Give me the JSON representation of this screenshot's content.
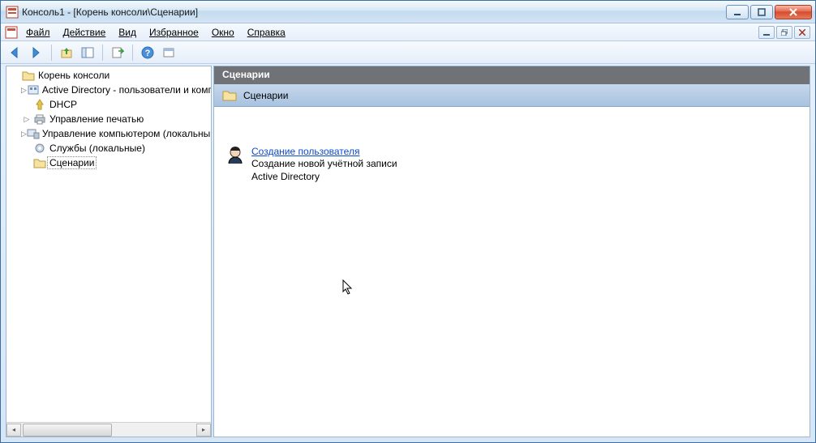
{
  "window": {
    "title": "Консоль1 - [Корень консоли\\Сценарии]"
  },
  "menu": {
    "file": "Файл",
    "action": "Действие",
    "view": "Вид",
    "favorites": "Избранное",
    "window": "Окно",
    "help": "Справка"
  },
  "tree": {
    "root": "Корень консоли",
    "items": [
      {
        "label": "Active Directory - пользователи и компьютеры",
        "expandable": true
      },
      {
        "label": "DHCP",
        "expandable": false
      },
      {
        "label": "Управление печатью",
        "expandable": true
      },
      {
        "label": "Управление компьютером (локальный)",
        "expandable": true
      },
      {
        "label": "Службы (локальные)",
        "expandable": false
      },
      {
        "label": "Сценарии",
        "expandable": false,
        "selected": true
      }
    ]
  },
  "main": {
    "header": "Сценарии",
    "subheader": "Сценарии",
    "item": {
      "link": "Создание пользователя",
      "desc_line1": "Создание новой учётной записи",
      "desc_line2": "Active Directory"
    }
  }
}
